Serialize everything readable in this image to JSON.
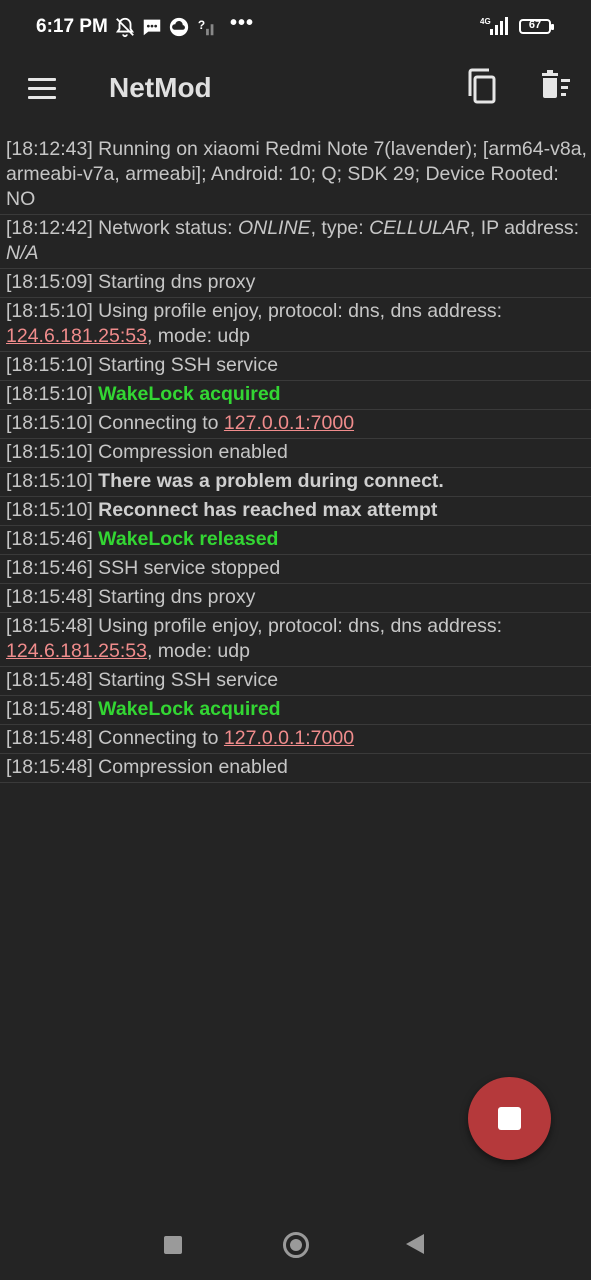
{
  "status_bar": {
    "time": "6:17 PM",
    "icons": [
      "bell-off-icon",
      "message-icon",
      "cloud-icon",
      "wifi-unknown-icon"
    ],
    "more": "•••",
    "network": "4G",
    "battery": "67"
  },
  "app_bar": {
    "title": "NetMod",
    "icons": [
      "menu-icon",
      "copy-icon",
      "delete-sweep-icon"
    ]
  },
  "log": [
    [
      {
        "t": "[18:12:43] Running on xiaomi Redmi Note 7(lavender); [arm64-v8a, armeabi-v7a, armeabi]; Android: 10; Q; SDK 29; Device Rooted: NO"
      }
    ],
    [
      {
        "t": "[18:12:42] Network status: "
      },
      {
        "t": "ONLINE",
        "c": "it"
      },
      {
        "t": ", type: "
      },
      {
        "t": "CELLULAR",
        "c": "it"
      },
      {
        "t": ", IP address: "
      },
      {
        "t": "N/A",
        "c": "it"
      }
    ],
    [
      {
        "t": "[18:15:09] Starting dns proxy"
      }
    ],
    [
      {
        "t": "[18:15:10] Using profile enjoy, protocol: dns, dns address: "
      },
      {
        "t": "124.6.181.25:53",
        "c": "link"
      },
      {
        "t": ", mode: udp"
      }
    ],
    [
      {
        "t": "[18:15:10] Starting SSH service"
      }
    ],
    [
      {
        "t": "[18:15:10] "
      },
      {
        "t": "WakeLock acquired",
        "c": "ok"
      }
    ],
    [
      {
        "t": "[18:15:10] Connecting to "
      },
      {
        "t": "127.0.0.1:7000",
        "c": "link"
      }
    ],
    [
      {
        "t": "[18:15:10] Compression enabled"
      }
    ],
    [
      {
        "t": "[18:15:10] "
      },
      {
        "t": "There was a problem during connect.",
        "c": "bold"
      }
    ],
    [
      {
        "t": "[18:15:10] "
      },
      {
        "t": "Reconnect has reached max attempt",
        "c": "bold"
      }
    ],
    [
      {
        "t": "[18:15:46] "
      },
      {
        "t": "WakeLock released",
        "c": "ok"
      }
    ],
    [
      {
        "t": "[18:15:46] SSH service stopped"
      }
    ],
    [
      {
        "t": "[18:15:48] Starting dns proxy"
      }
    ],
    [
      {
        "t": "[18:15:48] Using profile enjoy, protocol: dns, dns address: "
      },
      {
        "t": "124.6.181.25:53",
        "c": "link"
      },
      {
        "t": ", mode: udp"
      }
    ],
    [
      {
        "t": "[18:15:48] Starting SSH service"
      }
    ],
    [
      {
        "t": "[18:15:48] "
      },
      {
        "t": "WakeLock acquired",
        "c": "ok"
      }
    ],
    [
      {
        "t": "[18:15:48] Connecting to "
      },
      {
        "t": "127.0.0.1:7000",
        "c": "link"
      }
    ],
    [
      {
        "t": "[18:15:48] Compression enabled"
      }
    ]
  ],
  "fab": {
    "icon": "stop-icon",
    "color": "#b5393b"
  },
  "nav_bar": {
    "icons": [
      "recent-apps-icon",
      "home-icon",
      "back-icon"
    ]
  }
}
